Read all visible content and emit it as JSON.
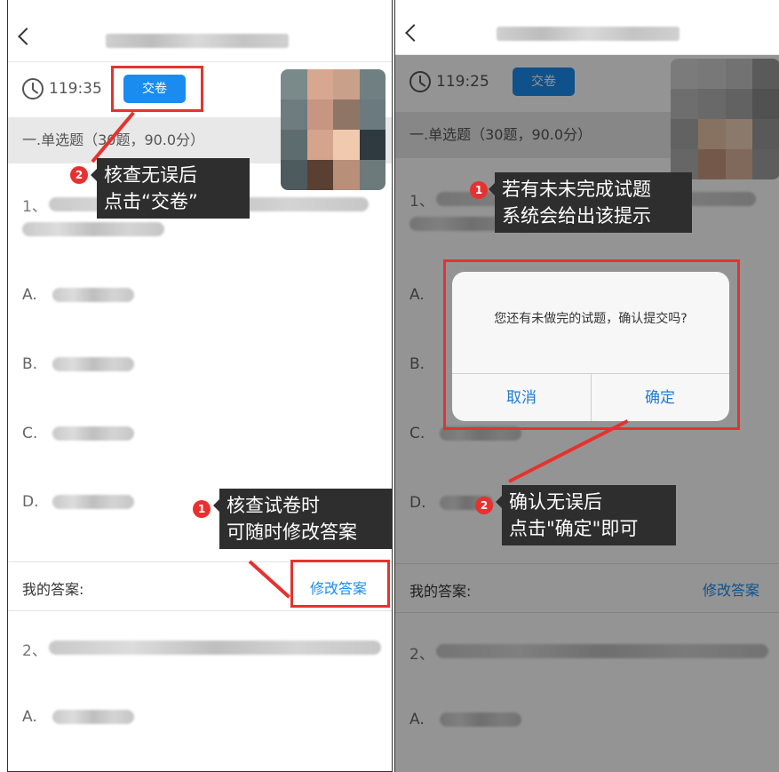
{
  "left": {
    "timer": "119:35",
    "submit_label": "交卷",
    "section_title": "一.单选题（30题，90.0分）",
    "q1_number": "1、",
    "options": [
      "A.",
      "B.",
      "C.",
      "D."
    ],
    "answer_label": "我的答案:",
    "modify_label": "修改答案",
    "q2_number": "2、",
    "q2_option": "A.",
    "callout1_badge": "1",
    "callout1_line1": "核查试卷时",
    "callout1_line2": "可随时修改答案",
    "callout2_badge": "2",
    "callout2_line1": "核查无误后",
    "callout2_line2": "点击“交卷”"
  },
  "right": {
    "timer": "119:25",
    "submit_label": "交卷",
    "section_title": "一.单选题（30题，90.0分）",
    "q1_number": "1、",
    "options": [
      "A.",
      "B.",
      "C.",
      "D."
    ],
    "answer_label": "我的答案:",
    "modify_label": "修改答案",
    "q2_number": "2、",
    "q2_option": "A.",
    "dialog_message": "您还有未做完的试题，确认提交吗?",
    "dialog_cancel": "取消",
    "dialog_confirm": "确定",
    "callout1_badge": "1",
    "callout1_line1": "若有未未完成试题",
    "callout1_line2": "系统会给出该提示",
    "callout2_badge": "2",
    "callout2_line1": "确认无误后",
    "callout2_line2": "点击\"确定\"即可"
  },
  "colors": {
    "accent": "#1a8cf0",
    "annotation_red": "#e6322e",
    "callout_bg": "#2e2e2e"
  },
  "icons": [
    "back-chevron-icon",
    "clock-icon"
  ]
}
